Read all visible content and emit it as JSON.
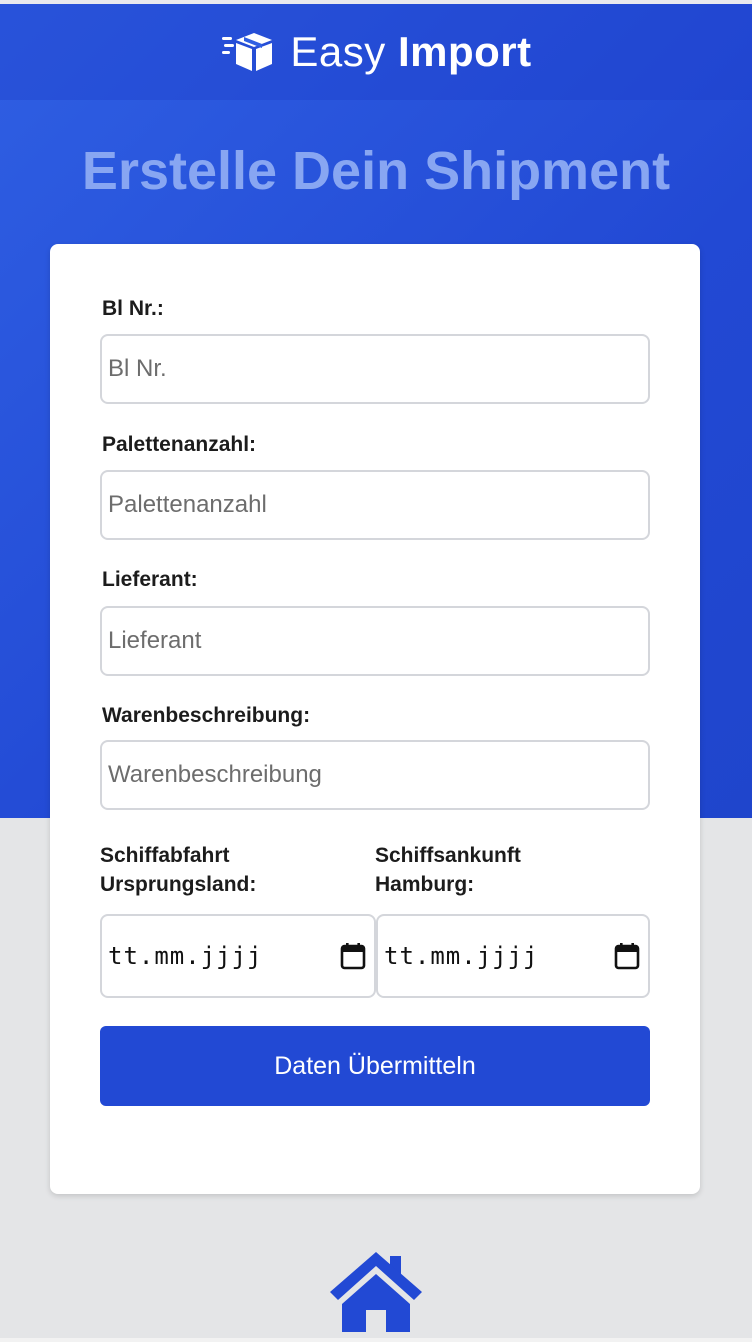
{
  "header": {
    "brand_light": "Easy",
    "brand_bold": "Import",
    "logo_icon": "package-box-icon"
  },
  "page": {
    "title": "Erstelle Dein Shipment"
  },
  "form": {
    "bl_nr": {
      "label": "Bl Nr.:",
      "placeholder": "Bl Nr.",
      "value": ""
    },
    "palettenanzahl": {
      "label": "Palettenanzahl:",
      "placeholder": "Palettenanzahl",
      "value": ""
    },
    "lieferant": {
      "label": "Lieferant:",
      "placeholder": "Lieferant",
      "value": ""
    },
    "warenbeschreibung": {
      "label": "Warenbeschreibung:",
      "placeholder": "Warenbeschreibung",
      "value": ""
    },
    "abfahrt": {
      "label_line1": "Schiffabfahrt",
      "label_line2": "Ursprungsland:",
      "value": "tt.mm.jjjj",
      "icon": "calendar-icon"
    },
    "ankunft": {
      "label_line1": "Schiffsankunft",
      "label_line2": "Hamburg:",
      "value": "tt.mm.jjjj",
      "icon": "calendar-icon"
    },
    "submit_label": "Daten Übermitteln"
  },
  "nav": {
    "home_icon": "home-icon"
  },
  "colors": {
    "primary": "#2249d4",
    "hero_gradient_start": "#2f5fe3",
    "title": "#88a6f2",
    "background": "#e4e5e7",
    "card": "#ffffff"
  }
}
